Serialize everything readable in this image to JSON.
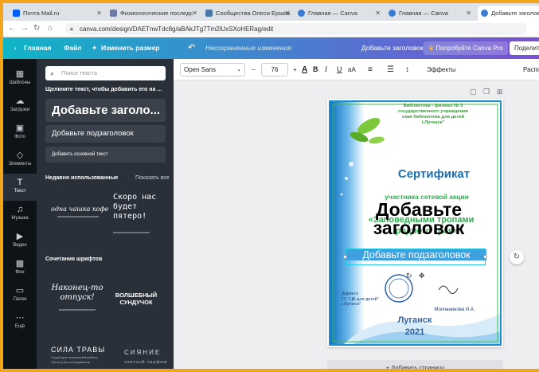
{
  "browser": {
    "tabs": [
      {
        "title": "Почта Mail.ru",
        "color": "#005ff9"
      },
      {
        "title": "Физиологические последс",
        "color": "#6d7aa1"
      },
      {
        "title": "Сообщества Олеси Ершов",
        "color": "#4a76a8"
      },
      {
        "title": "Главная — Canva",
        "color": "#3a7bd5"
      },
      {
        "title": "Главная — Canva",
        "color": "#3a7bd5"
      },
      {
        "title": "Добавьте заголовок -",
        "color": "#3a7bd5"
      }
    ],
    "url": "canva.com/design/DAETnwTdc8g/aBAkJTg7Tm2lUxSXoHERag/edit"
  },
  "topbar": {
    "home": "Главная",
    "file": "Файл",
    "resize": "Изменить размер",
    "unsaved": "Несохраненные изменения",
    "design_title": "Добавьте заголовок",
    "pro": "Попробуйте Canva Pro",
    "share": "Поделить"
  },
  "rail": [
    {
      "label": "Шаблоны",
      "icon": "▦"
    },
    {
      "label": "Загрузки",
      "icon": "☁"
    },
    {
      "label": "Фото",
      "icon": "▣"
    },
    {
      "label": "Элементы",
      "icon": "◇"
    },
    {
      "label": "Текст",
      "icon": "T"
    },
    {
      "label": "Музыка",
      "icon": "♫"
    },
    {
      "label": "Видео",
      "icon": "▶"
    },
    {
      "label": "Фон",
      "icon": "▩"
    },
    {
      "label": "Папки",
      "icon": "▭"
    },
    {
      "label": "Ещё",
      "icon": "⋯"
    }
  ],
  "panel": {
    "search_placeholder": "Поиск текста",
    "hint": "Щелкните текст, чтобы добавить его на ...",
    "add_heading": "Добавьте заголо...",
    "add_subheading": "Добавьте подзаголовок",
    "add_body": "Добавить основной текст",
    "recent_title": "Недавно использованные",
    "show_all": "Показать все",
    "combos_title": "Сочетания шрифтов",
    "recent": [
      {
        "main": "одна чашка кофе",
        "sub": ""
      },
      {
        "main": "Скоро нас будет пятеро!",
        "sub": ""
      }
    ],
    "combos": [
      {
        "main": "Наконец-то отпуск!",
        "sub": ""
      },
      {
        "main": "ВОЛШЕБНЫЙ СУНДУЧОК",
        "sub": ""
      },
      {
        "main": "СИЛА ТРАВЫ",
        "sub": "Сырой для тела ручной работы\n100 мл | без консервантов"
      },
      {
        "main": "СИЯНИЕ",
        "sub": "элитный парфюм"
      }
    ]
  },
  "toolbar": {
    "font": "Open Sans",
    "size": "76",
    "minus": "−",
    "plus": "+",
    "effects": "Эффекты",
    "position": "Располо"
  },
  "certificate": {
    "header": "Библиотека - филиал № 3\nгосударственного учреждения\nская библиотека для детей\nг.Луганск\"",
    "title": "Сертификат",
    "line1": "участника сетевой акции",
    "line2": "«Заповедными тропами",
    "line3": "родного края»",
    "heading": "Добавьте\nзаголовок",
    "subheading": "Добавьте подзаголовок",
    "director": "Директо\nГУ \"ЦБ для детей\"\nг.Луганск\"",
    "signer": "Молчанинова И.А.",
    "city": "Луганск",
    "year": "2021"
  },
  "add_page": "+ Добавить страницу",
  "colors": {
    "accent": "#f2a51a",
    "blue_text": "#1a6fb5",
    "green_text": "#2fae4e"
  }
}
